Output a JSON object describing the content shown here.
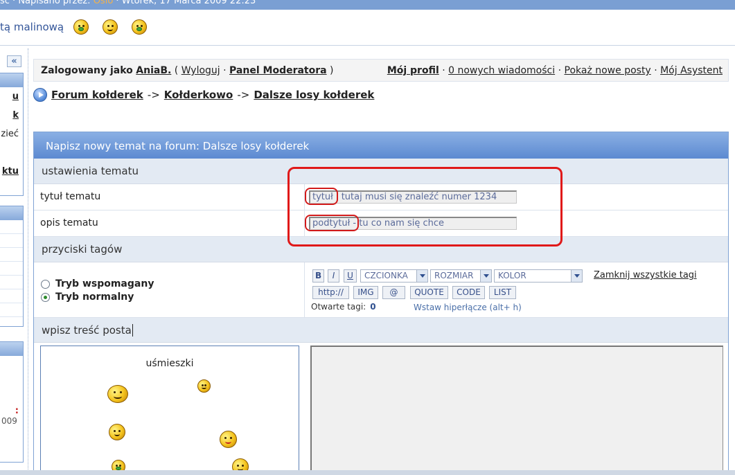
{
  "topbar": {
    "prefix": "sc · Napisano przez: ",
    "author": "Oslo",
    "date": " · Wtorek, 17 Marca 2009 22:23"
  },
  "emoticon_row": {
    "text": "tą malinową"
  },
  "sidebar": {
    "collapse_label": "«",
    "links": [
      "u",
      "k",
      "zieć",
      "",
      "ktu"
    ],
    "red_text": ":",
    "date_text": "009"
  },
  "userbar": {
    "logged_as_label": "Zalogowany jako",
    "username": "AniaB.",
    "logout": "Wyloguj",
    "moderator_panel": "Panel Moderatora",
    "my_profile": "Mój profil",
    "new_messages": "0 nowych wiadomości",
    "show_new_posts": "Pokaż nowe posty",
    "my_assistant": "Mój Asystent"
  },
  "breadcrumb": {
    "items": [
      "Forum kołderek",
      "Kołderkowo",
      "Dalsze losy kołderek"
    ],
    "separator": "->"
  },
  "form": {
    "title": "Napisz nowy temat na forum: Dalsze losy kołderek",
    "topic_settings_header": "ustawienia tematu",
    "topic_title_label": "tytuł tematu",
    "topic_title_value": "tytuł i tutaj musi się znaleźć numer 1234",
    "topic_desc_label": "opis tematu",
    "topic_desc_value": "podtytuł - tu co nam się chce",
    "tag_buttons_header": "przyciski tagów",
    "mode_assisted": "Tryb wspomagany",
    "mode_normal": "Tryb normalny",
    "selected_mode": "normal",
    "btn_bold": "B",
    "btn_italic": "I",
    "btn_underline": "U",
    "font_select": "CZCIONKA",
    "size_select": "ROZMIAR",
    "color_select": "KOLOR",
    "close_all_tags": "Zamknij wszystkie tagi",
    "btn_http": "http://",
    "btn_img": "IMG",
    "btn_at": "@",
    "btn_quote": "QUOTE",
    "btn_code": "CODE",
    "btn_list": "LIST",
    "open_tags_label": "Otwarte tagi:",
    "open_tags_count": "0",
    "hint": "Wstaw hiperłącze (alt+ h)",
    "post_content_header": "wpisz treść posta",
    "smileys_title": "uśmieszki"
  },
  "colors": {
    "panel_header": "#5c8ad1",
    "section_bg": "#e3eaf3",
    "annotation": "#e01919"
  },
  "icons": [
    "collapse-icon",
    "breadcrumb-arrow-icon",
    "smiley-icon",
    "radio-icon",
    "dropdown-arrow-icon"
  ]
}
